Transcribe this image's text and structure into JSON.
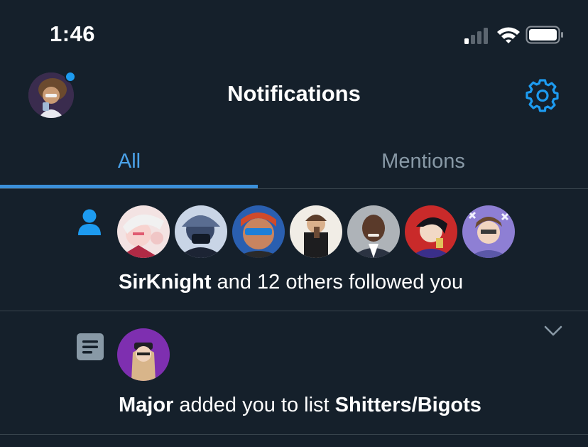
{
  "status_bar": {
    "time": "1:46",
    "signal_icon": "signal-bars-icon",
    "wifi_icon": "wifi-icon",
    "battery_icon": "battery-icon"
  },
  "header": {
    "title": "Notifications",
    "settings_icon": "gear-icon"
  },
  "tabs": [
    {
      "label": "All",
      "active": true
    },
    {
      "label": "Mentions",
      "active": false
    }
  ],
  "notifications": [
    {
      "icon": "person-icon",
      "avatar_count": 7,
      "actor": "SirKnight",
      "text": " and 12 others followed you"
    },
    {
      "icon": "list-icon",
      "actor": "Major",
      "text": " added you to list ",
      "target": "Shitters/Bigots",
      "menu_icon": "chevron-down-icon"
    }
  ],
  "colors": {
    "background": "#15202b",
    "accent": "#1d9bf0",
    "divider": "#38444d",
    "muted": "#8899a6"
  }
}
